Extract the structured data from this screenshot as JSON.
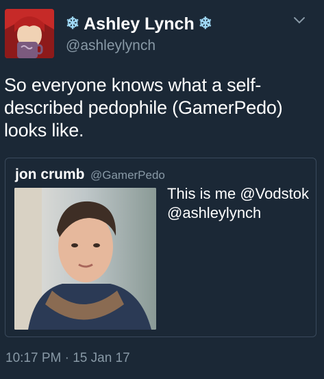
{
  "author": {
    "name": "Ashley Lynch",
    "handle": "@ashleylynch",
    "name_decoration_icon": "snowflake-icon",
    "accent_color": "#9fd8f5"
  },
  "menu": {
    "icon": "chevron-down-icon"
  },
  "tweet": {
    "text": "So everyone knows what a self-described pedophile (GamerPedo) looks like."
  },
  "quoted_tweet": {
    "name": "jon crumb",
    "handle": "@GamerPedo",
    "text": "This is me @Vodstok @ashleylynch"
  },
  "timestamp": "10:17 PM · 15 Jan 17",
  "colors": {
    "background": "#1b2836",
    "secondary_text": "#8899a6",
    "border": "#3a4a5c"
  }
}
